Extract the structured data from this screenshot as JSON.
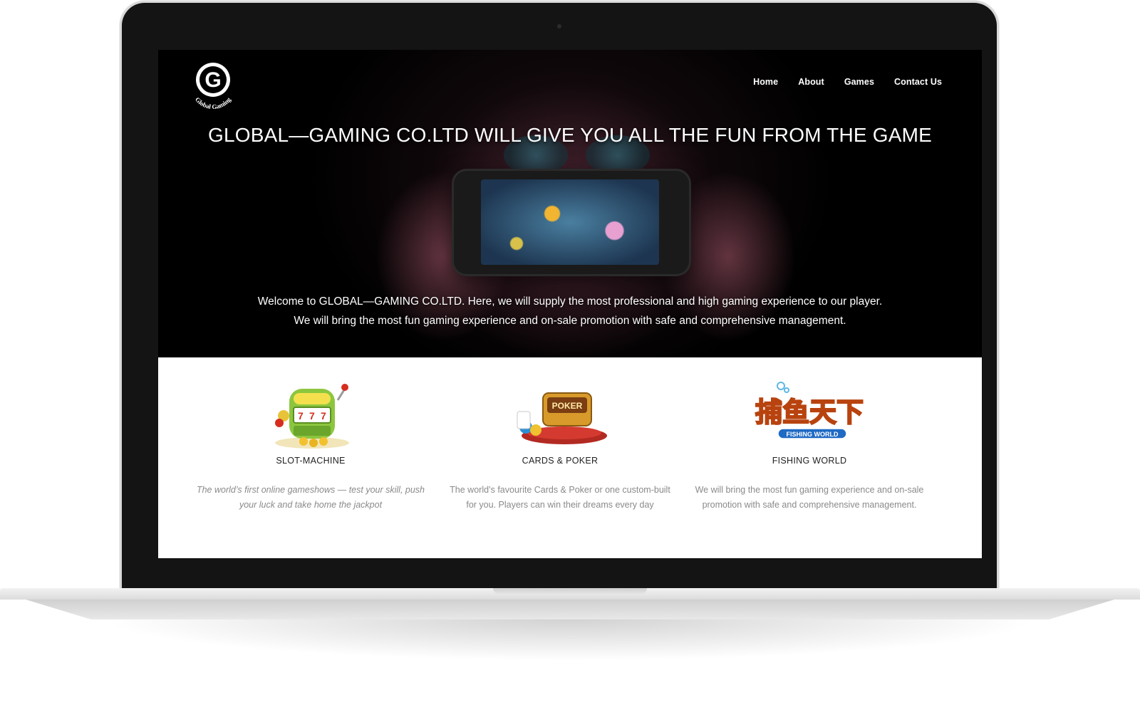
{
  "brand": {
    "logo_letter": "G",
    "logo_text": "Global Gaming"
  },
  "nav": {
    "items": [
      {
        "label": "Home"
      },
      {
        "label": "About"
      },
      {
        "label": "Games"
      },
      {
        "label": "Contact Us"
      }
    ]
  },
  "hero": {
    "title": "GLOBAL—GAMING CO.LTD WILL GIVE YOU ALL THE FUN FROM THE GAME",
    "line1": "Welcome to GLOBAL—GAMING CO.LTD. Here, we will supply the most professional and high gaming experience to our player.",
    "line2": "We will bring the most fun gaming experience and on-sale promotion with safe and comprehensive management."
  },
  "features": [
    {
      "name": "SLOT-MACHINE",
      "icon": "slot-machine-icon",
      "desc_line1": "The world’s first online gameshows — test your skill, push",
      "desc_line2": "your luck and take home the jackpot"
    },
    {
      "name": "CARDS & POKER",
      "icon": "poker-icon",
      "badge": "POKER",
      "desc_line1": "The world’s favourite Cards & Poker or one custom-built",
      "desc_line2": "for you. Players can win their dreams every day"
    },
    {
      "name": "FISHING WORLD",
      "icon": "fishing-world-logo",
      "logo_cn": "捕鱼天下",
      "logo_en": "FISHING WORLD",
      "desc_line1": "We will bring the most fun gaming experience and on-sale",
      "desc_line2": "promotion with safe and comprehensive management."
    }
  ]
}
